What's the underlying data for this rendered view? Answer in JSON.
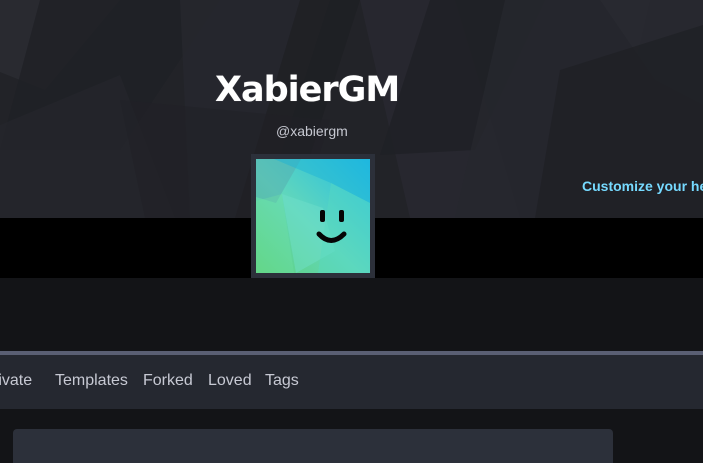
{
  "profile": {
    "display_name": "XabierGM",
    "username": "@xabiergm",
    "customize_link": "Customize your he",
    "avatar_icon": "smiley-avatar-icon"
  },
  "tabs": [
    {
      "label": "rivate"
    },
    {
      "label": "Templates"
    },
    {
      "label": "Forked"
    },
    {
      "label": "Loved"
    },
    {
      "label": "Tags"
    }
  ],
  "colors": {
    "background": "#131417",
    "header_background": "#222328",
    "accent_link": "#76daff",
    "tab_bar": "#252830",
    "tab_text": "#c7c9d3",
    "card": "#2c303a"
  }
}
